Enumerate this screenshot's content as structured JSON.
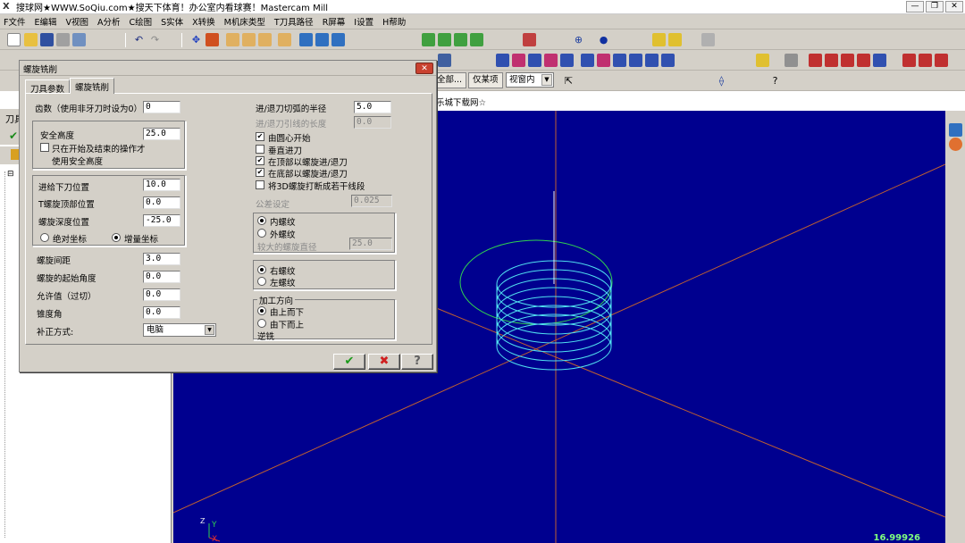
{
  "window": {
    "title": "搜球网★WWW.SoQiu.com★搜天下体育！办公室内看球赛！Mastercam Mill",
    "minimize": "—",
    "maximize": "❐",
    "close": "✕"
  },
  "menu": [
    "F文件",
    "E编辑",
    "V视图",
    "A分析",
    "C绘图",
    "S实体",
    "X转换",
    "M机床类型",
    "T刀具路径",
    "R屏幕",
    "I设置",
    "H帮助"
  ],
  "toolbar3": {
    "btn_all": "全部...",
    "btn_only": "仅某项",
    "view_select": "视窗内"
  },
  "viewport_label": "乐城下载网☆",
  "left_pane": {
    "header": "刀具",
    "tree_marker": "⊟"
  },
  "status": {
    "value": "16.99926"
  },
  "axis_labels": {
    "y": "Y",
    "x": "X",
    "z": "Z"
  },
  "dialog": {
    "title": "螺旋铣削",
    "close": "✕",
    "tabs": [
      "刀具参数",
      "螺旋铣削"
    ],
    "left": {
      "teeth_label": "齿数（使用非牙刀时设为0）",
      "teeth_value": "0",
      "safe_height_label": "安全高度",
      "safe_height_value": "25.0",
      "only_start_end_label1": "只在开始及结束的操作才",
      "only_start_end_label2": "使用安全高度",
      "feed_pos_label": "进给下刀位置",
      "feed_pos_value": "10.0",
      "top_pos_label": "T螺旋顶部位置",
      "top_pos_value": "0.0",
      "depth_pos_label": "螺旋深度位置",
      "depth_pos_value": "-25.0",
      "abs_label": "绝对坐标",
      "inc_label": "增量坐标",
      "pitch_label": "螺旋间距",
      "pitch_value": "3.0",
      "start_angle_label": "螺旋的起始角度",
      "start_angle_value": "0.0",
      "allowance_label": "允许值（过切）",
      "allowance_value": "0.0",
      "taper_label": "锥度角",
      "taper_value": "0.0",
      "comp_label": "补正方式:",
      "comp_value": "电脑"
    },
    "right": {
      "arc_radius_label": "进/退刀切弧的半径",
      "arc_radius_value": "5.0",
      "lead_len_label": "进/退刀引线的长度",
      "lead_len_value": "0.0",
      "cb_center_start": "由圆心开始",
      "cb_vertical": "垂直进刀",
      "cb_top_helix": "在顶部以螺旋进/退刀",
      "cb_bottom_helix": "在底部以螺旋进/退刀",
      "cb_3d_break": "将3D螺旋打断成若干线段",
      "tolerance_label": "公差设定",
      "tolerance_value": "0.025",
      "internal_label": "内螺纹",
      "external_label": "外螺纹",
      "major_dia_label": "较大的螺旋直径",
      "major_dia_value": "25.0",
      "right_hand_label": "右螺纹",
      "left_hand_label": "左螺纹",
      "direction_group_label": "加工方向",
      "top_down_label": "由上而下",
      "bottom_up_label": "由下而上",
      "climb_label": "逆铣"
    },
    "ok": "✔",
    "cancel": "✖",
    "help": "?"
  }
}
